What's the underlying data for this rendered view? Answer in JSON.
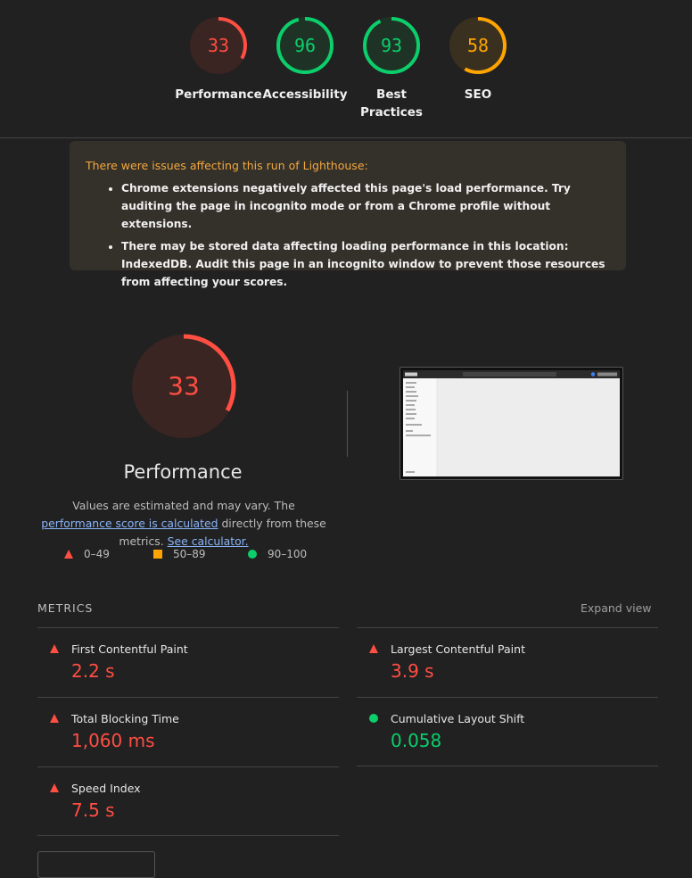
{
  "colors": {
    "fail": "#ff4e42",
    "average": "#ffa400",
    "pass": "#0cce6b"
  },
  "gauges": [
    {
      "score": "33",
      "value": 33,
      "label": "Performance",
      "color": "#ff4e42",
      "bg": "#3a2523"
    },
    {
      "score": "96",
      "value": 96,
      "label": "Accessibility",
      "color": "#0cce6b",
      "bg": "#1e3325"
    },
    {
      "score": "93",
      "value": 93,
      "label": "Best Practices",
      "color": "#0cce6b",
      "bg": "#1e3325"
    },
    {
      "score": "58",
      "value": 58,
      "label": "SEO",
      "color": "#ffa400",
      "bg": "#3a3020"
    }
  ],
  "warning": {
    "heading": "There were issues affecting this run of Lighthouse:",
    "items": [
      "Chrome extensions negatively affected this page's load performance. Try auditing the page in incognito mode or from a Chrome profile without extensions.",
      "There may be stored data affecting loading performance in this location: IndexedDB. Audit this page in an incognito window to prevent those resources from affecting your scores."
    ]
  },
  "performance": {
    "score": "33",
    "value": 33,
    "title": "Performance",
    "desc_part1": "Values are estimated and may vary. The ",
    "desc_link1": "performance score is calculated",
    "desc_part2": " directly from these metrics. ",
    "desc_link2": "See calculator."
  },
  "legend": {
    "fail": "0–49",
    "average": "50–89",
    "pass": "90–100"
  },
  "metrics_heading": "METRICS",
  "expand_label": "Expand view",
  "metrics": [
    {
      "name": "First Contentful Paint",
      "value": "2.2 s",
      "status": "fail"
    },
    {
      "name": "Largest Contentful Paint",
      "value": "3.9 s",
      "status": "fail"
    },
    {
      "name": "Total Blocking Time",
      "value": "1,060 ms",
      "status": "fail"
    },
    {
      "name": "Cumulative Layout Shift",
      "value": "0.058",
      "status": "pass"
    },
    {
      "name": "Speed Index",
      "value": "7.5 s",
      "status": "fail"
    }
  ]
}
